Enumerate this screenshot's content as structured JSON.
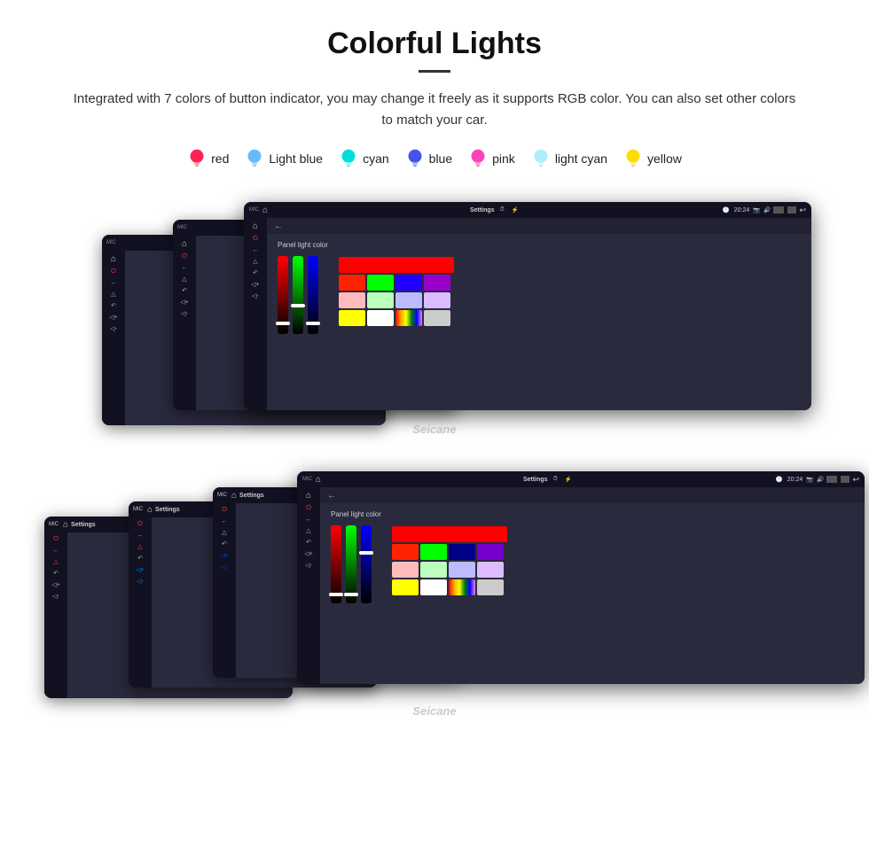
{
  "header": {
    "title": "Colorful Lights",
    "description": "Integrated with 7 colors of button indicator, you may change it freely as it supports RGB color. You can also set other colors to match your car."
  },
  "colors": [
    {
      "name": "red",
      "color": "#ff3366",
      "bulb": "🔴"
    },
    {
      "name": "Light blue",
      "color": "#66ccff",
      "bulb": "💧"
    },
    {
      "name": "cyan",
      "color": "#00ffff",
      "bulb": "💧"
    },
    {
      "name": "blue",
      "color": "#4466ff",
      "bulb": "💧"
    },
    {
      "name": "pink",
      "color": "#ff44aa",
      "bulb": "💧"
    },
    {
      "name": "light cyan",
      "color": "#aaeeff",
      "bulb": "💧"
    },
    {
      "name": "yellow",
      "color": "#ffdd00",
      "bulb": "💡"
    }
  ],
  "device": {
    "settings_title": "Settings",
    "panel_light_label": "Panel light color",
    "back_label": "←",
    "time": "20:24",
    "watermark": "Seicane"
  },
  "color_grid_top": [
    [
      "#ff0000",
      "#ff0000",
      "#ff0000",
      "#ff0000"
    ],
    [
      "#ff0000",
      "#00ff00",
      "#0000ff",
      "#aa00ff"
    ],
    [
      "#ffaaaa",
      "#aaffaa",
      "#aaaaff",
      "#ccaaff"
    ],
    [
      "#ffff00",
      "#ffffff",
      "rainbow",
      "#ffffff"
    ]
  ],
  "color_grid_bottom": [
    [
      "#ff0000",
      "#ff0000",
      "#ff0000",
      "#ff0000"
    ],
    [
      "#ff0000",
      "#00ff00",
      "#0000aa",
      "#8800ff"
    ],
    [
      "#ffbbbb",
      "#bbffbb",
      "#bbbbff",
      "#ccbbff"
    ],
    [
      "#ffff00",
      "#ffffff",
      "rainbow2",
      "#ffffff"
    ]
  ]
}
